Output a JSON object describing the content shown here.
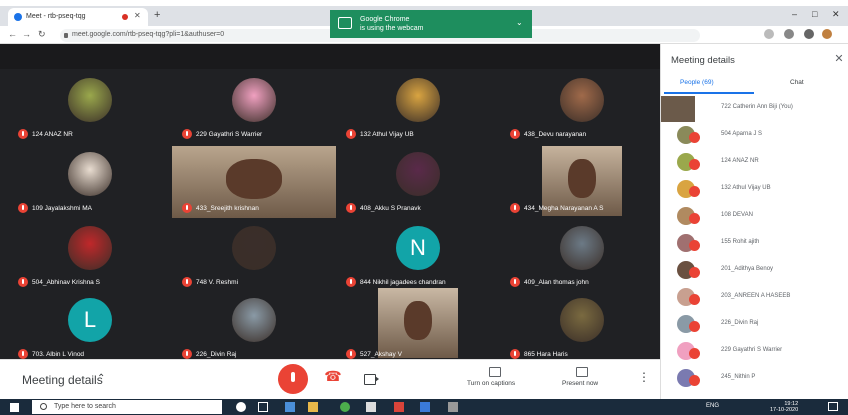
{
  "browser": {
    "tab_title": "Meet - rtb-pseq-tqg",
    "omnibox_url": "meet.google.com/rtb-pseq-tqg?pli=1&authuser=0",
    "notification_title": "Google Chrome",
    "notification_text": "is using the webcam"
  },
  "meeting": {
    "tiles": [
      {
        "name": "124 ANAZ NR",
        "kind": "avatar",
        "color": "#9aa84c"
      },
      {
        "name": "229 Gayathri S Warrier",
        "kind": "avatar",
        "color": "#f0a0c0"
      },
      {
        "name": "132 Athul Vijay UB",
        "kind": "avatar",
        "color": "#d9a441"
      },
      {
        "name": "438_Devu narayanan",
        "kind": "avatar",
        "color": "#a06a4a"
      },
      {
        "name": "109 Jayalakshmi MA",
        "kind": "avatar",
        "color": "#e8dcd0"
      },
      {
        "name": "433_Sreejith krishnan",
        "kind": "video",
        "color": "#b9a58d"
      },
      {
        "name": "408_Akku S Pranavk",
        "kind": "avatar",
        "color": "#5a2a4a"
      },
      {
        "name": "434_Megha Narayanan A S",
        "kind": "video",
        "color": "#c6b39d"
      },
      {
        "name": "504_Abhinav Krishna S",
        "kind": "avatar",
        "color": "#c0282a"
      },
      {
        "name": "748 V. Reshmi",
        "kind": "avatar",
        "color": "#3a2e2a"
      },
      {
        "name": "844 Nikhil jagadees chandran",
        "kind": "letter",
        "letter": "N",
        "color": "#12a4a8"
      },
      {
        "name": "409_Alan thomas john",
        "kind": "avatar",
        "color": "#6c7a86"
      },
      {
        "name": "703. Albin L Vinod",
        "kind": "letter",
        "letter": "L",
        "color": "#12a4a8"
      },
      {
        "name": "226_Divin Raj",
        "kind": "avatar",
        "color": "#8a9aa6"
      },
      {
        "name": "527_Akshay V",
        "kind": "video",
        "color": "#c9b8a4"
      },
      {
        "name": "865 Hara Haris",
        "kind": "avatar",
        "color": "#7a6a40"
      }
    ]
  },
  "controls": {
    "meeting_details": "Meeting details",
    "captions_label": "Turn on captions",
    "present_label": "Present now"
  },
  "panel": {
    "title": "Meeting details",
    "people_tab": "People (69)",
    "chat_tab": "Chat",
    "participants": [
      {
        "name": "722 Catherin Ann Biji (You)",
        "color": "#6b5a4a"
      },
      {
        "name": "504 Aparna J S",
        "color": "#8a8a5a"
      },
      {
        "name": "124 ANAZ NR",
        "color": "#9aa84c"
      },
      {
        "name": "132 Athul Vijay UB",
        "color": "#d9a441"
      },
      {
        "name": "108 DEVAN",
        "color": "#b08a60"
      },
      {
        "name": "155 Rohit ajith",
        "color": "#a07070"
      },
      {
        "name": "201_Adithya Benoy",
        "color": "#6a5040"
      },
      {
        "name": "203_ANREEN A HASEEB",
        "color": "#c8a090"
      },
      {
        "name": "226_Divin Raj",
        "color": "#8a9aa6"
      },
      {
        "name": "229 Gayathri S Warrier",
        "color": "#f0a0c0"
      },
      {
        "name": "245_Nithin P",
        "color": "#7a7ab0"
      }
    ]
  },
  "taskbar": {
    "search_placeholder": "Type here to search",
    "clock_time": "19:12",
    "clock_date": "17-10-2020",
    "lang": "ENG"
  }
}
